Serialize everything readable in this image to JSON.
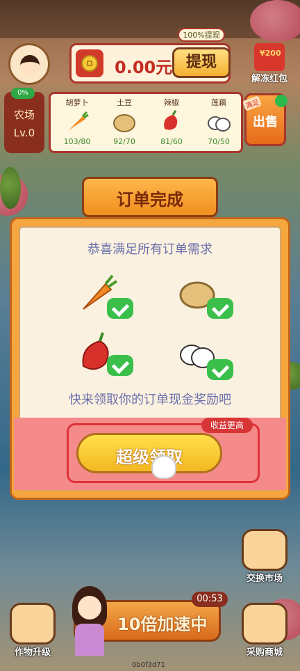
{
  "header": {
    "money": "0.00元",
    "withdraw_tag": "100%提现",
    "withdraw_button": "提现",
    "redpack_amount": "¥200",
    "redpack_label": "解冻红包"
  },
  "farm": {
    "percent": "0%",
    "name": "农场",
    "level": "Lv.0"
  },
  "crops": [
    {
      "name": "胡萝卜",
      "count": "103/80"
    },
    {
      "name": "土豆",
      "count": "92/70"
    },
    {
      "name": "辣椒",
      "count": "81/60"
    },
    {
      "name": "莲藕",
      "count": "70/50"
    }
  ],
  "sell": {
    "label": "出售",
    "tag": "满足"
  },
  "modal": {
    "title": "订单完成",
    "congrats": "恭喜满足所有订单需求",
    "hint": "快来领取你的订单现金奖励吧",
    "claim_button": "超级领取",
    "income_tag": "收益更高"
  },
  "bottom": {
    "exchange_label": "交换市场",
    "upgrade_label": "作物升级",
    "purchase_label": "采购商城",
    "speed_label": "10倍加速中",
    "timer": "00:53",
    "version": "0b0f3d71"
  },
  "colors": {
    "accent_red": "#a8362b",
    "check_green": "#3bbf4b",
    "button_yellow": "#f4b722"
  }
}
